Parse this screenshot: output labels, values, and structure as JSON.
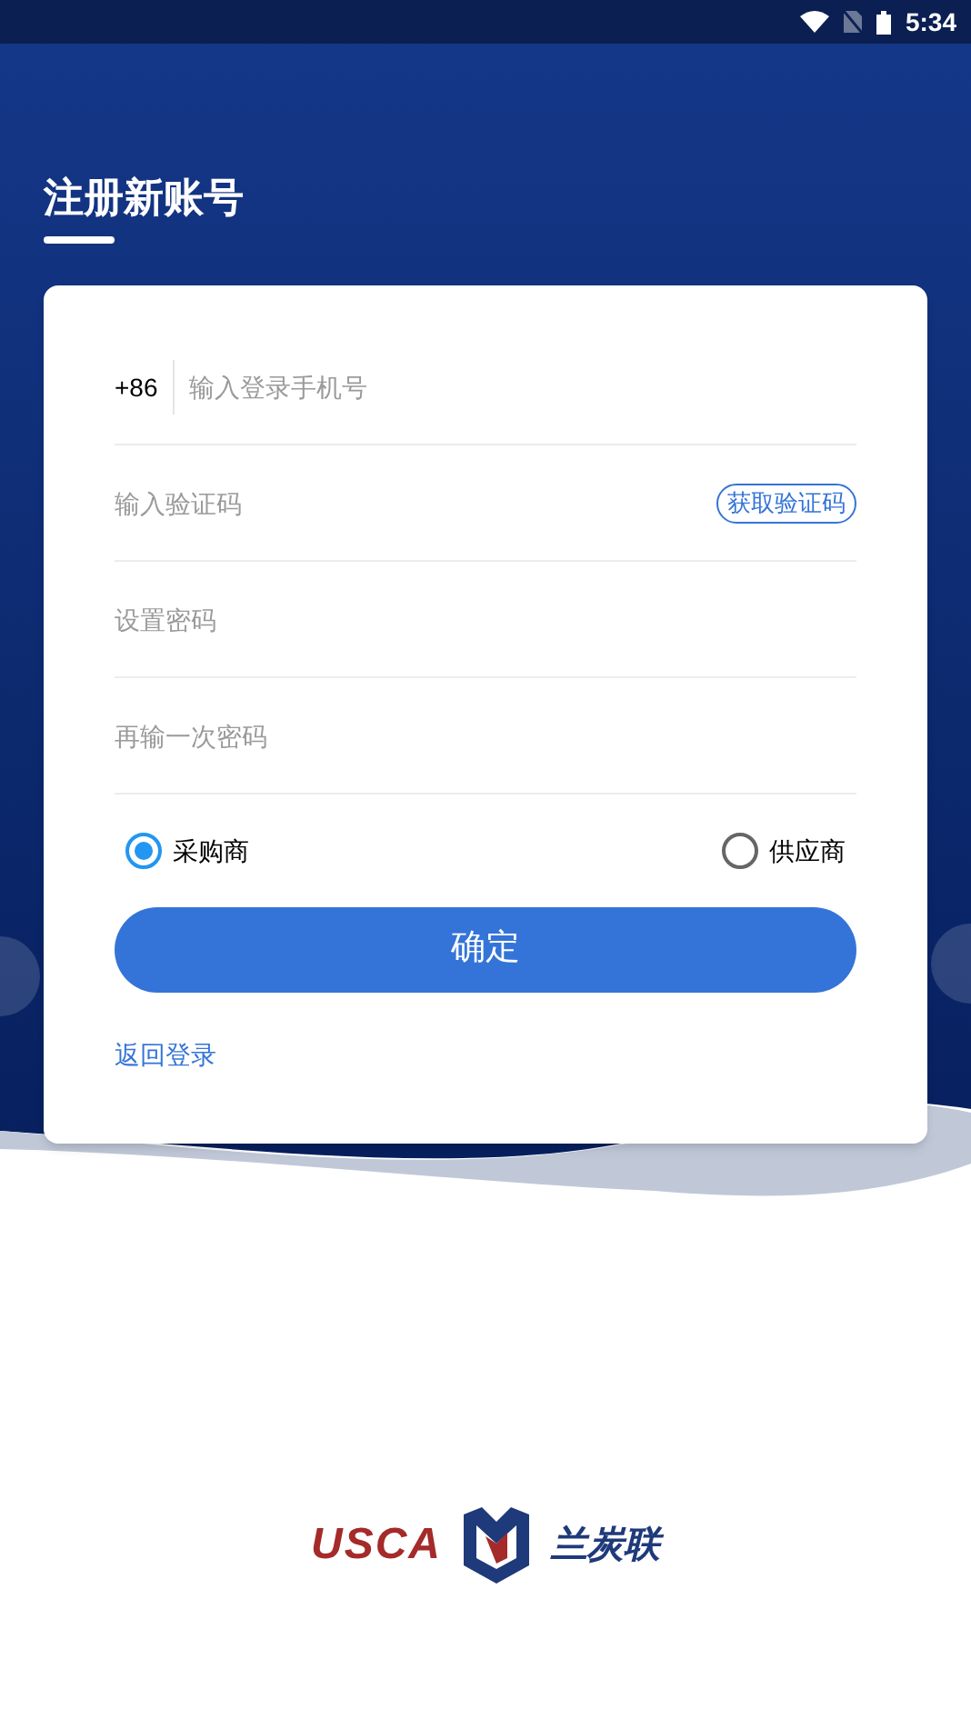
{
  "status_bar": {
    "time": "5:34"
  },
  "title": "注册新账号",
  "form": {
    "country_code": "+86",
    "fields": [
      {
        "kind": "phone",
        "placeholder": "输入登录手机号"
      },
      {
        "kind": "code",
        "placeholder": "输入验证码"
      },
      {
        "kind": "password",
        "placeholder": "设置密码"
      },
      {
        "kind": "password",
        "placeholder": "再输一次密码"
      }
    ],
    "get_code_button": "获取验证码",
    "roles": [
      {
        "label": "采购商",
        "selected": true
      },
      {
        "label": "供应商",
        "selected": false
      }
    ],
    "submit_button": "确定",
    "back_link": "返回登录"
  },
  "logo": {
    "latin": "USCA",
    "chinese": "兰炭联"
  }
}
